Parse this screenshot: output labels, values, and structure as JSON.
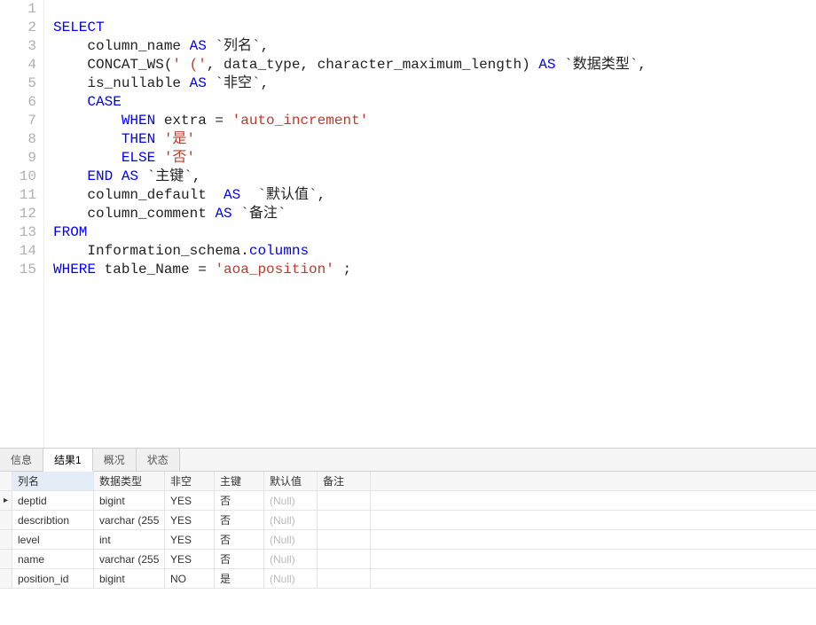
{
  "code": {
    "lines": [
      [
        {
          "t": "",
          "c": "ident"
        }
      ],
      [
        {
          "t": "SELECT",
          "c": "kw"
        }
      ],
      [
        {
          "t": "    column_name ",
          "c": "ident"
        },
        {
          "t": "AS",
          "c": "kw"
        },
        {
          "t": " `列名`,",
          "c": "bt"
        }
      ],
      [
        {
          "t": "    CONCAT_WS(",
          "c": "ident"
        },
        {
          "t": "' ('",
          "c": "str"
        },
        {
          "t": ", data_type, character_maximum_length) ",
          "c": "ident"
        },
        {
          "t": "AS",
          "c": "kw"
        },
        {
          "t": " `数据类型`,",
          "c": "bt"
        }
      ],
      [
        {
          "t": "    is_nullable ",
          "c": "ident"
        },
        {
          "t": "AS",
          "c": "kw"
        },
        {
          "t": " `非空`,",
          "c": "bt"
        }
      ],
      [
        {
          "t": "    ",
          "c": "ident"
        },
        {
          "t": "CASE",
          "c": "kw"
        }
      ],
      [
        {
          "t": "        ",
          "c": "ident"
        },
        {
          "t": "WHEN",
          "c": "kw"
        },
        {
          "t": " extra = ",
          "c": "ident"
        },
        {
          "t": "'auto_increment'",
          "c": "str"
        }
      ],
      [
        {
          "t": "        ",
          "c": "ident"
        },
        {
          "t": "THEN",
          "c": "kw"
        },
        {
          "t": " ",
          "c": "ident"
        },
        {
          "t": "'是'",
          "c": "str"
        }
      ],
      [
        {
          "t": "        ",
          "c": "ident"
        },
        {
          "t": "ELSE",
          "c": "kw"
        },
        {
          "t": " ",
          "c": "ident"
        },
        {
          "t": "'否'",
          "c": "str"
        }
      ],
      [
        {
          "t": "    ",
          "c": "ident"
        },
        {
          "t": "END",
          "c": "kw"
        },
        {
          "t": " ",
          "c": "ident"
        },
        {
          "t": "AS",
          "c": "kw"
        },
        {
          "t": " `主键`,",
          "c": "bt"
        }
      ],
      [
        {
          "t": "    column_default  ",
          "c": "ident"
        },
        {
          "t": "AS",
          "c": "kw"
        },
        {
          "t": "  `默认值`,",
          "c": "bt"
        }
      ],
      [
        {
          "t": "    column_comment ",
          "c": "ident"
        },
        {
          "t": "AS",
          "c": "kw"
        },
        {
          "t": " `备注`",
          "c": "bt"
        }
      ],
      [
        {
          "t": "FROM",
          "c": "kw"
        }
      ],
      [
        {
          "t": "    Information_schema.",
          "c": "ident"
        },
        {
          "t": "columns",
          "c": "col"
        }
      ],
      [
        {
          "t": "WHERE",
          "c": "kw"
        },
        {
          "t": " table_Name = ",
          "c": "ident"
        },
        {
          "t": "'aoa_position'",
          "c": "str"
        },
        {
          "t": " ;",
          "c": "ident"
        }
      ]
    ]
  },
  "tabs": {
    "items": [
      "信息",
      "结果1",
      "概况",
      "状态"
    ],
    "activeIndex": 1
  },
  "grid": {
    "headers": [
      "列名",
      "数据类型",
      "非空",
      "主键",
      "默认值",
      "备注"
    ],
    "rows": [
      {
        "cur": true,
        "cells": [
          "deptid",
          "bigint",
          "YES",
          "否",
          "(Null)",
          ""
        ]
      },
      {
        "cur": false,
        "cells": [
          "describtion",
          "varchar (255",
          "YES",
          "否",
          "(Null)",
          ""
        ]
      },
      {
        "cur": false,
        "cells": [
          "level",
          "int",
          "YES",
          "否",
          "(Null)",
          ""
        ]
      },
      {
        "cur": false,
        "cells": [
          "name",
          "varchar (255",
          "YES",
          "否",
          "(Null)",
          ""
        ]
      },
      {
        "cur": false,
        "cells": [
          "position_id",
          "bigint",
          "NO",
          "是",
          "(Null)",
          ""
        ]
      }
    ]
  }
}
